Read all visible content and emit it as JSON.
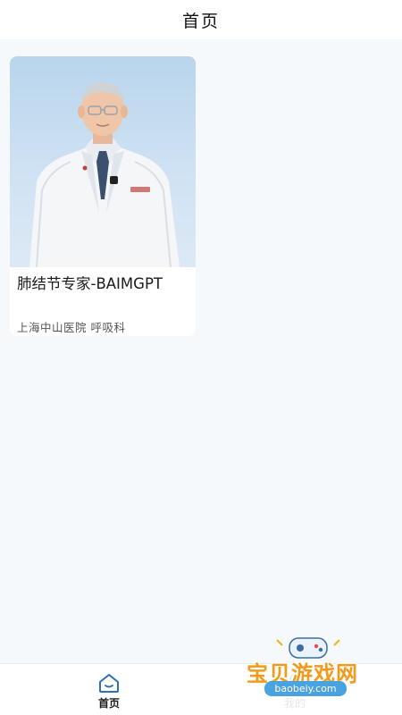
{
  "header": {
    "title": "首页"
  },
  "card": {
    "title": "肺结节专家-BAIMGPT",
    "subtitle": "上海中山医院 呼吸科",
    "photo_icon": "doctor-portrait"
  },
  "nav": {
    "home_label": "首页",
    "mine_label": "我的",
    "home_icon": "home-icon",
    "mine_icon": "user-icon",
    "active_color": "#1a1a1a"
  },
  "watermark": {
    "text": "宝贝游戏网",
    "url": "baobeiy.com",
    "color": "#f29a1c"
  }
}
